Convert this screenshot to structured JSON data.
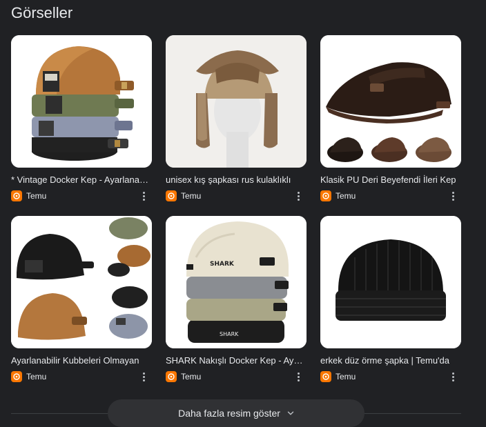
{
  "section": {
    "title": "Görseller"
  },
  "results": [
    {
      "caption": "* Vintage Docker Kep - Ayarlanabilir",
      "source": "Temu",
      "icon": "hat-stack-image"
    },
    {
      "caption": "unisex kış şapkası rus kulaklıklı",
      "source": "Temu",
      "icon": "trapper-hat-image"
    },
    {
      "caption": "Klasik PU Deri Beyefendi İleri Kep",
      "source": "Temu",
      "icon": "leather-cap-image"
    },
    {
      "caption": "Ayarlanabilir Kubbeleri Olmayan",
      "source": "Temu",
      "icon": "docker-caps-image"
    },
    {
      "caption": "SHARK Nakışlı Docker Kep - Ayarlanabilir",
      "source": "Temu",
      "icon": "shark-caps-image"
    },
    {
      "caption": "erkek düz örme şapka | Temu'da",
      "source": "Temu",
      "icon": "beanie-image"
    }
  ],
  "show_more": {
    "label": "Daha fazla resim göster"
  },
  "colors": {
    "background": "#202124",
    "button": "#303134",
    "temu": "#fb7701"
  }
}
